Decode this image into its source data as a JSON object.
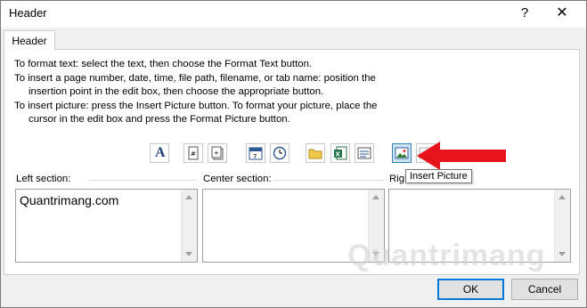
{
  "window": {
    "title": "Header",
    "help_glyph": "?",
    "close_glyph": "✕"
  },
  "tab": {
    "label": "Header"
  },
  "instructions": [
    "To format text:  select the text, then choose the Format Text button.",
    "To insert a page number, date, time, file path, filename, or tab name:  position the",
    "insertion point in the edit box, then choose the appropriate button.",
    "To insert picture: press the Insert Picture button.  To format your picture, place the",
    "cursor in the edit box and press the Format Picture button."
  ],
  "toolbar": {
    "format_text_glyph": "A",
    "buttons": [
      {
        "name": "format-text",
        "icon": "format-text-icon"
      },
      {
        "name": "insert-page-number",
        "icon": "page-number-icon"
      },
      {
        "name": "insert-number-of-pages",
        "icon": "number-of-pages-icon"
      },
      {
        "name": "insert-date",
        "icon": "calendar-icon"
      },
      {
        "name": "insert-time",
        "icon": "clock-icon"
      },
      {
        "name": "insert-file-path",
        "icon": "folder-icon"
      },
      {
        "name": "insert-file-name",
        "icon": "excel-file-icon"
      },
      {
        "name": "insert-sheet-name",
        "icon": "sheet-tab-icon"
      },
      {
        "name": "insert-picture",
        "icon": "picture-icon"
      },
      {
        "name": "format-picture",
        "icon": "format-picture-icon"
      }
    ]
  },
  "sections": {
    "left": {
      "label": "Left section:",
      "value": "Quantrimang.com"
    },
    "center": {
      "label": "Center section:",
      "value": ""
    },
    "right": {
      "label": "Righ",
      "value": ""
    }
  },
  "tooltip": {
    "text": "Insert Picture"
  },
  "buttons": {
    "ok": "OK",
    "cancel": "Cancel"
  },
  "watermark": {
    "text": "Quantrimang"
  },
  "colors": {
    "annotation_arrow": "#e8141b",
    "active_button": "#cce4f7",
    "default_button_border": "#0078d7"
  }
}
